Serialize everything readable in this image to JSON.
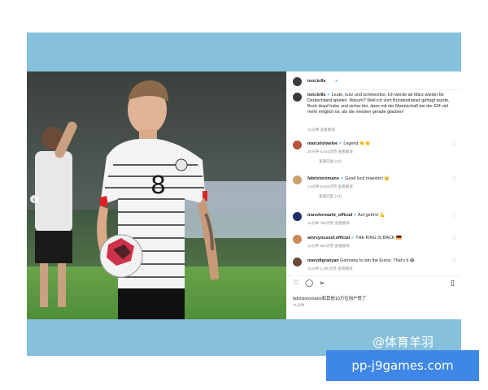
{
  "post": {
    "author": "toni.kr8s",
    "caption_user": "toni.kr8s",
    "caption": "Leute, kurz und schmerzlos: Ich werde ab März wieder für Deutschland spielen. Warum? Weil ich vom Bundestrainer gefragt wurde, Bock drauf habe und sicher bin, dass mit der Mannschaft bei der EM viel mehr möglich ist, als die meisten gerade glauben!",
    "caption_meta": "21分钟  查看翻译",
    "jersey_number": "8"
  },
  "comments": [
    {
      "user": "marcelotwelve",
      "text": "Legend 👏👏",
      "meta": "20分钟  5,810次赞  查看翻译",
      "replies": "查看回复 (32)",
      "avatar_color": "#b8503c"
    },
    {
      "user": "fabrizioromano",
      "text": "Good luck maestro! 👑",
      "meta": "14分钟  8,526次赞  查看翻译",
      "replies": "查看回复 (13)",
      "avatar_color": "#c9a06b"
    },
    {
      "user": "transfermarkt_official",
      "text": "Auf geht's! 💪",
      "meta": "11分钟  785次赞  查看翻译",
      "replies": "",
      "avatar_color": "#1f2e64"
    },
    {
      "user": "amrsyoussef.official",
      "text": "THE KING IS BACK 🇩🇪",
      "meta": "11分钟  583次赞  查看翻译",
      "replies": "",
      "avatar_color": "#c98a5a"
    },
    {
      "user": "marydlgranyan",
      "text": "Germany to win the Euros. That's it 😂",
      "meta": "11分钟  1,386次赞  查看翻译",
      "replies": "",
      "avatar_color": "#6b4a3a"
    }
  ],
  "likes_text": "fabrizioromano和其他10万位用户赞了",
  "likes_time": "21分钟",
  "watermark": "@体育羊羽",
  "site_badge": "pp-j9games.com",
  "icons": [
    "heart-icon",
    "comment-icon",
    "share-icon",
    "bookmark-icon",
    "verified-icon"
  ]
}
